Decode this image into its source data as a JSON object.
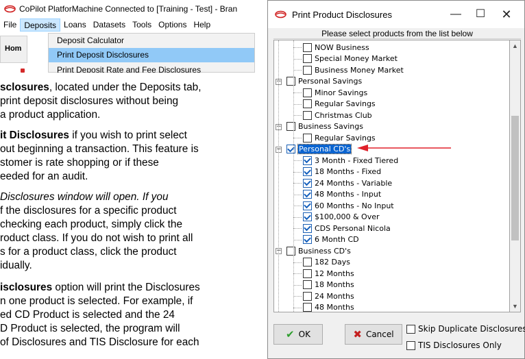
{
  "app": {
    "title": "CoPilot PlatforMachine Connected to [Training - Test] - Bran",
    "menu": [
      "File",
      "Deposits",
      "Loans",
      "Datasets",
      "Tools",
      "Options",
      "Help"
    ],
    "home_tab": "Hom",
    "dropdown": {
      "items": [
        "Deposit Calculator",
        "Print Deposit Disclosures",
        "Print Deposit Rate and Fee Disclosures"
      ]
    }
  },
  "doc": {
    "lines": [
      [
        "sclosures",
        ", located under the Deposits tab,"
      ],
      [
        "",
        "print deposit disclosures without being"
      ],
      [
        "",
        "a product application."
      ],
      [
        "it Disclosures",
        " if you wish to print select"
      ],
      [
        "",
        "out beginning a transaction. This feature is"
      ],
      [
        "",
        "stomer is rate shopping or if these"
      ],
      [
        "",
        "eeded for an audit."
      ],
      [
        "",
        "Disclosures window will open. If you"
      ],
      [
        "",
        "f the disclosures for a specific product"
      ],
      [
        "",
        "checking each product, simply click the"
      ],
      [
        "",
        "roduct class. If you do not wish to print all"
      ],
      [
        "",
        "s for a product class, click the product"
      ],
      [
        "",
        "idually."
      ],
      [
        "isclosures",
        " option will print the Disclosures"
      ],
      [
        "",
        "n one product is selected. For example, if"
      ],
      [
        "",
        "ed CD Product is selected and the 24"
      ],
      [
        "",
        "D Product is selected, the program will"
      ],
      [
        "",
        "of Disclosures and TIS Disclosure for each"
      ]
    ]
  },
  "dialog": {
    "title": "Print Product Disclosures",
    "instruction": "Please select products from the list below",
    "tree": [
      {
        "label": "NOW Business",
        "level": 1,
        "checked": false
      },
      {
        "label": "Special Money Market",
        "level": 1,
        "checked": false
      },
      {
        "label": "Business Money Market",
        "level": 1,
        "checked": false
      },
      {
        "label": "Personal Savings",
        "level": 0,
        "checked": false
      },
      {
        "label": "Minor Savings",
        "level": 1,
        "checked": false
      },
      {
        "label": "Regular Savings",
        "level": 1,
        "checked": false
      },
      {
        "label": "Christmas Club",
        "level": 1,
        "checked": false
      },
      {
        "label": "Business Savings",
        "level": 0,
        "checked": false
      },
      {
        "label": "Regular Savings",
        "level": 1,
        "checked": false
      },
      {
        "label": "Personal CD's",
        "level": 0,
        "checked": true,
        "selected": true
      },
      {
        "label": "3 Month - Fixed Tiered",
        "level": 1,
        "checked": true
      },
      {
        "label": "18 Months - Fixed",
        "level": 1,
        "checked": true
      },
      {
        "label": "24 Months - Variable",
        "level": 1,
        "checked": true
      },
      {
        "label": "48 Months - Input",
        "level": 1,
        "checked": true
      },
      {
        "label": "60 Months - No Input",
        "level": 1,
        "checked": true
      },
      {
        "label": "$100,000 & Over",
        "level": 1,
        "checked": true
      },
      {
        "label": "CDS Personal Nicola",
        "level": 1,
        "checked": true
      },
      {
        "label": "6 Month CD",
        "level": 1,
        "checked": true
      },
      {
        "label": "Business CD's",
        "level": 0,
        "checked": false
      },
      {
        "label": "182 Days",
        "level": 1,
        "checked": false
      },
      {
        "label": "12 Months",
        "level": 1,
        "checked": false
      },
      {
        "label": "18 Months",
        "level": 1,
        "checked": false
      },
      {
        "label": "24 Months",
        "level": 1,
        "checked": false
      },
      {
        "label": "48 Months",
        "level": 1,
        "checked": false
      }
    ],
    "ok_label": "OK",
    "cancel_label": "Cancel",
    "skip_duplicate_label": "Skip Duplicate Disclosures",
    "tis_only_label": "TIS Disclosures Only"
  },
  "colors": {
    "selection": "#0a64d0",
    "menu_active": "#cce8ff",
    "dropdown_highlight": "#91c9f7",
    "arrow": "#e0202a",
    "ok_check": "#2e9e2e",
    "cancel_x": "#c41e1e"
  },
  "icons": {
    "app": "copilot-logo-icon",
    "dialog": "copilot-logo-icon",
    "minimize": "minimize-icon",
    "maximize": "maximize-icon",
    "close": "close-icon"
  }
}
